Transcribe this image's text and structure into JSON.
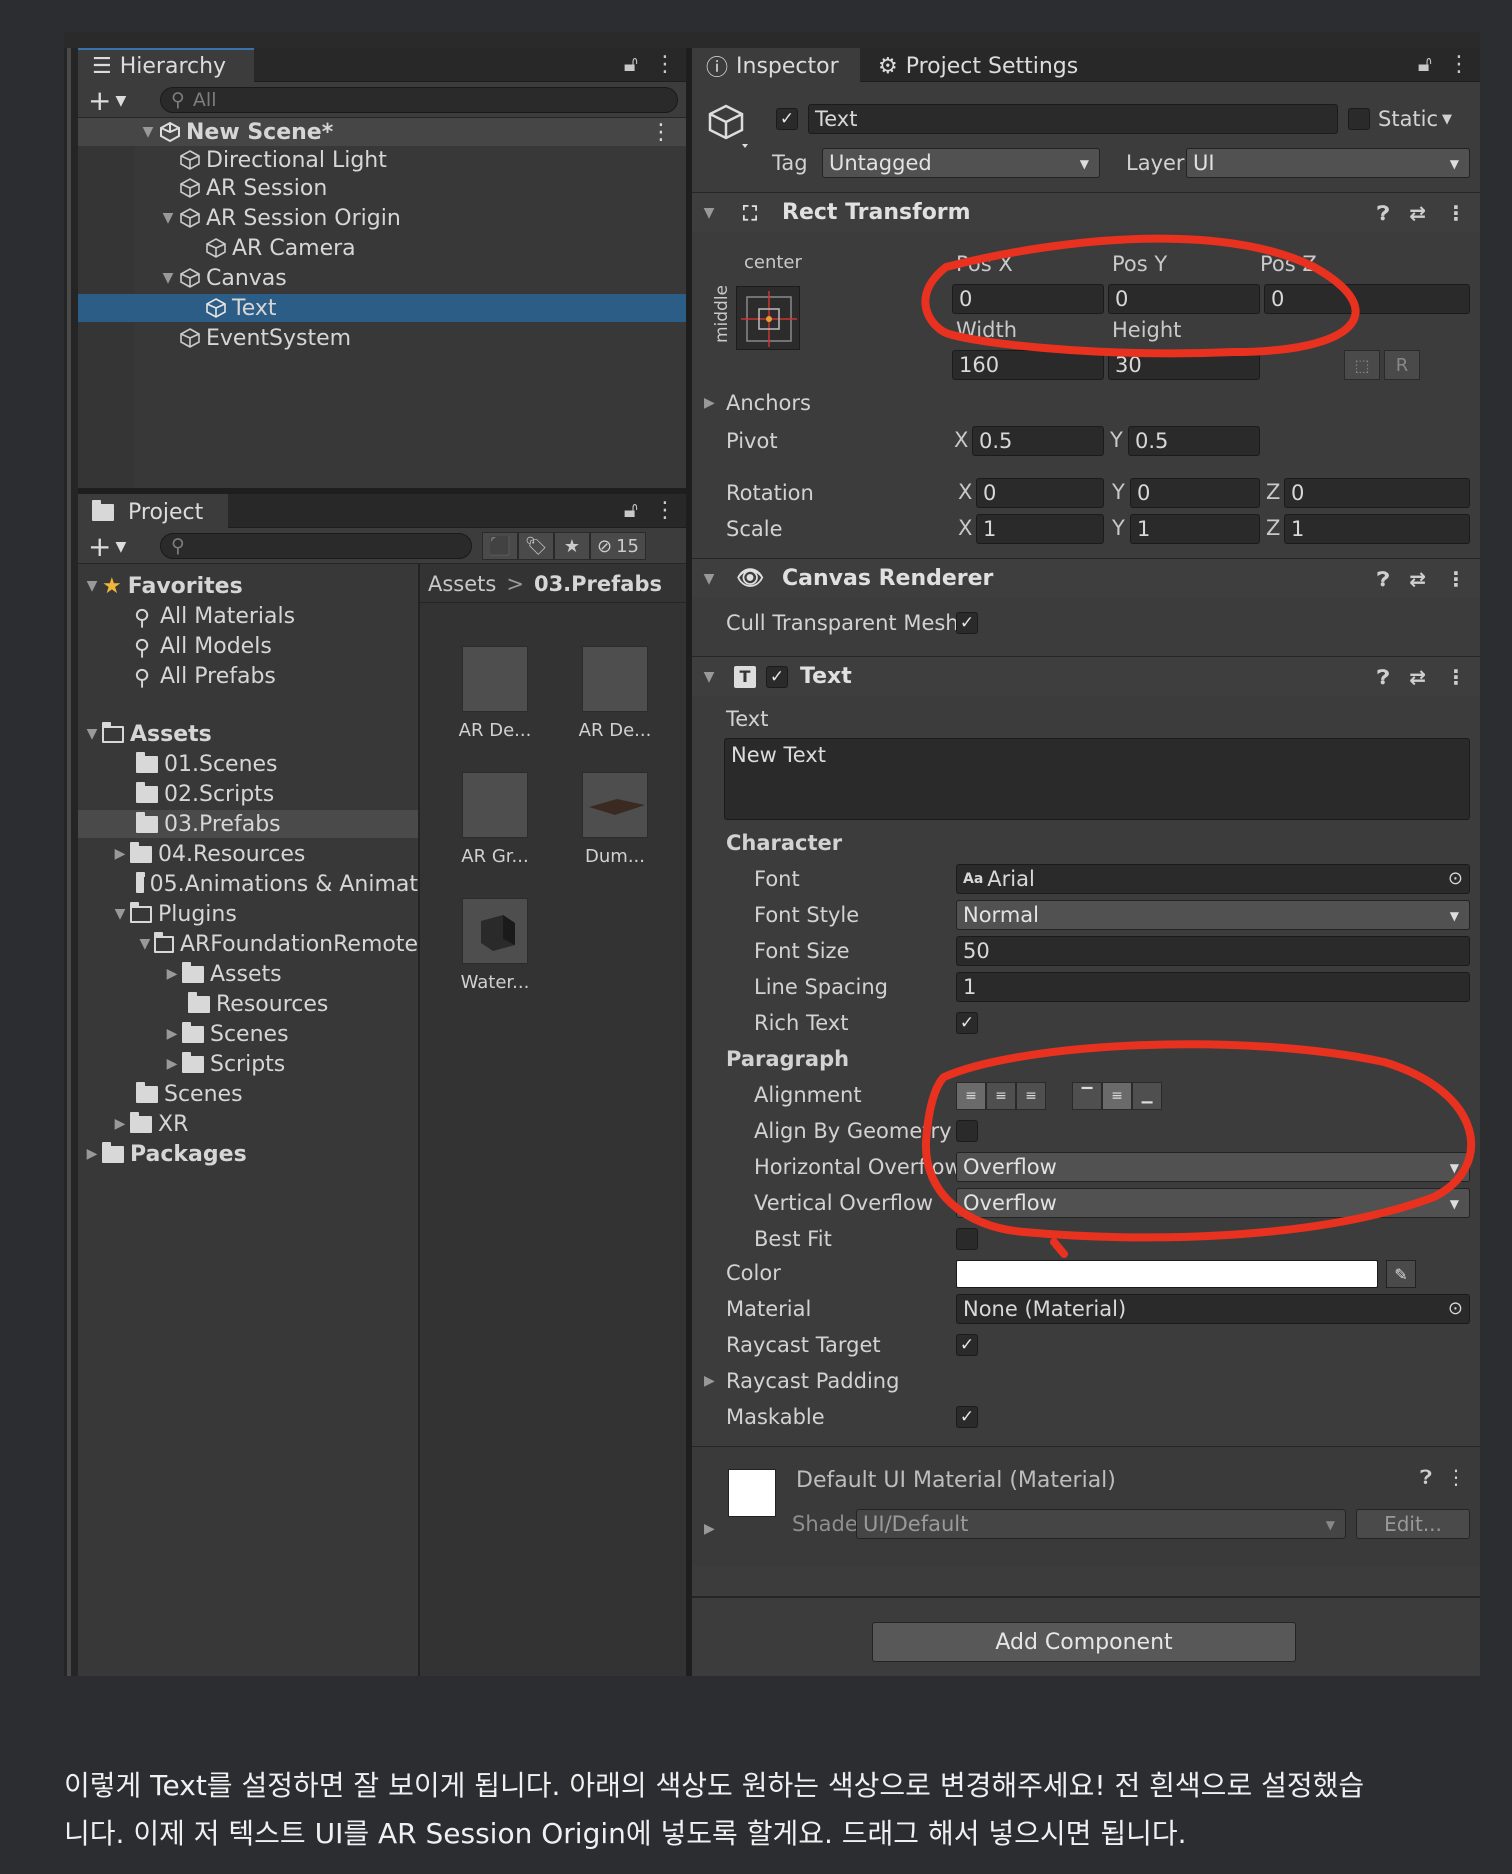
{
  "hierarchy": {
    "tab_label": "Hierarchy",
    "search_placeholder": "All",
    "scene": "New Scene*",
    "items": [
      "Directional Light",
      "AR Session",
      "AR Session Origin",
      "AR Camera",
      "Canvas",
      "Text",
      "EventSystem"
    ]
  },
  "project": {
    "tab_label": "Project",
    "hidden_count": "15",
    "favorites_label": "Favorites",
    "favorites": [
      "All Materials",
      "All Models",
      "All Prefabs"
    ],
    "assets_label": "Assets",
    "assets": [
      "01.Scenes",
      "02.Scripts",
      "03.Prefabs",
      "04.Resources",
      "05.Animations & Animat"
    ],
    "plugins_label": "Plugins",
    "arfoundation_label": "ARFoundationRemote",
    "arfoundation_children": [
      "Assets",
      "Resources",
      "Scenes",
      "Scripts"
    ],
    "scenes_label": "Scenes",
    "xr_label": "XR",
    "packages_label": "Packages",
    "breadcrumb_root": "Assets",
    "breadcrumb_sep": ">",
    "breadcrumb_current": "03.Prefabs",
    "grid_items": [
      "AR De...",
      "AR De...",
      "AR Gr...",
      "Dum...",
      "Water..."
    ]
  },
  "inspector": {
    "tab_label": "Inspector",
    "settings_tab_label": "Project Settings",
    "object_name": "Text",
    "static_label": "Static",
    "tag_label": "Tag",
    "tag_value": "Untagged",
    "layer_label": "Layer",
    "layer_value": "UI",
    "rect": {
      "title": "Rect Transform",
      "anchor_h": "center",
      "anchor_v": "middle",
      "posx_label": "Pos X",
      "posy_label": "Pos Y",
      "posz_label": "Pos Z",
      "posx": "0",
      "posy": "0",
      "posz": "0",
      "width_label": "Width",
      "height_label": "Height",
      "width": "160",
      "height": "30",
      "r_btn": "R",
      "anchors_label": "Anchors",
      "pivot_label": "Pivot",
      "pivot_x": "0.5",
      "pivot_y": "0.5",
      "rotation_label": "Rotation",
      "rot_x": "0",
      "rot_y": "0",
      "rot_z": "0",
      "scale_label": "Scale",
      "scale_x": "1",
      "scale_y": "1",
      "scale_z": "1",
      "x": "X",
      "y": "Y",
      "z": "Z"
    },
    "canvas_renderer": {
      "title": "Canvas Renderer",
      "cull_label": "Cull Transparent Mesh"
    },
    "text_comp": {
      "title": "Text",
      "text_label": "Text",
      "text_value": "New Text",
      "character_label": "Character",
      "font_label": "Font",
      "font_value": "Arial",
      "font_icon_text": "Aa",
      "font_style_label": "Font Style",
      "font_style_value": "Normal",
      "font_size_label": "Font Size",
      "font_size_value": "50",
      "line_spacing_label": "Line Spacing",
      "line_spacing_value": "1",
      "rich_text_label": "Rich Text",
      "paragraph_label": "Paragraph",
      "alignment_label": "Alignment",
      "align_geom_label": "Align By Geometry",
      "horiz_overflow_label": "Horizontal Overflow",
      "horiz_overflow_value": "Overflow",
      "vert_overflow_label": "Vertical Overflow",
      "vert_overflow_value": "Overflow",
      "best_fit_label": "Best Fit",
      "color_label": "Color",
      "color_value": "#ffffff",
      "material_label": "Material",
      "material_value": "None (Material)",
      "raycast_target_label": "Raycast Target",
      "raycast_padding_label": "Raycast Padding",
      "maskable_label": "Maskable"
    },
    "material_section": {
      "title": "Default UI Material (Material)",
      "shader_label": "Shader",
      "shader_value": "UI/Default",
      "edit_label": "Edit..."
    },
    "add_component": "Add Component"
  },
  "caption": {
    "line1": "이렇게 Text를 설정하면 잘 보이게 됩니다.  아래의 색상도 원하는 색상으로 변경해주세요! 전 흰색으로 설정했습",
    "line2": "니다. 이제 저 텍스트 UI를 AR Session Origin에 넣도록 할게요. 드래그 해서 넣으시면 됩니다."
  },
  "colors": {
    "selection": "#2c5d87",
    "annotation": "#e8311f",
    "panel": "#383838",
    "page": "#2b2d30"
  }
}
